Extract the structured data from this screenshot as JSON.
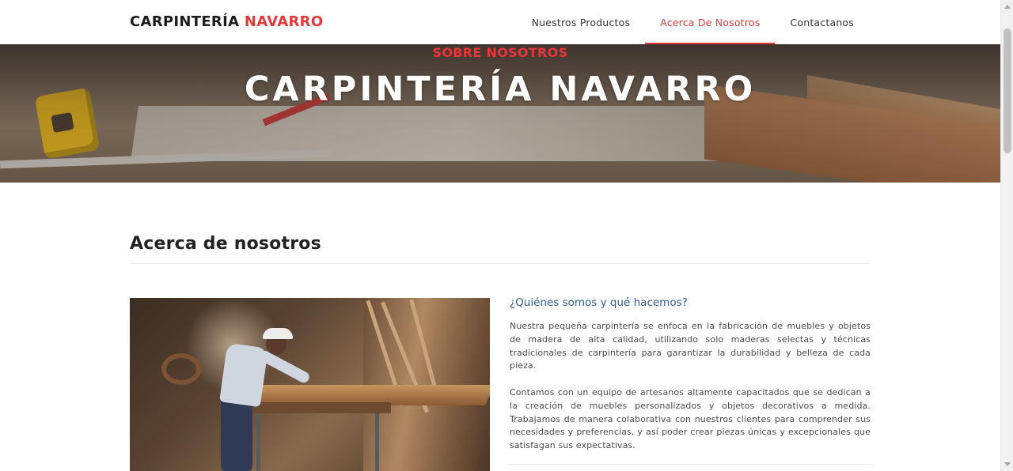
{
  "header": {
    "brand_primary": "CARPINTERÍA",
    "brand_accent": "NAVARRO",
    "nav": [
      {
        "label": "Nuestros Productos",
        "active": false
      },
      {
        "label": "Acerca De Nosotros",
        "active": true
      },
      {
        "label": "Contactanos",
        "active": false
      }
    ],
    "accent_color": "#e23b3b"
  },
  "hero": {
    "tag": "SOBRE NOSOTROS",
    "title": "CARPINTERÍA NAVARRO"
  },
  "about": {
    "title": "Acerca de nosotros",
    "subhead": "¿Quiénes somos y qué hacemos?",
    "paragraph_1": "Nuestra pequeña carpintería se enfoca en la fabricación de muebles y objetos de madera de alta calidad, utilizando solo maderas selectas y técnicas tradicionales de carpintería para garantizar la durabilidad y belleza de cada pieza.",
    "paragraph_2": "Contamos con un equipo de artesanos altamente capacitados que se dedican a la creación de muebles personalizados y objetos decorativos a medida. Trabajamos de manera colaborativa con nuestros clientes para comprender sus necesidades y preferencias, y así poder crear piezas únicas y excepcionales que satisfagan sus expectativas.",
    "subhead_color": "#2c5e8e"
  }
}
